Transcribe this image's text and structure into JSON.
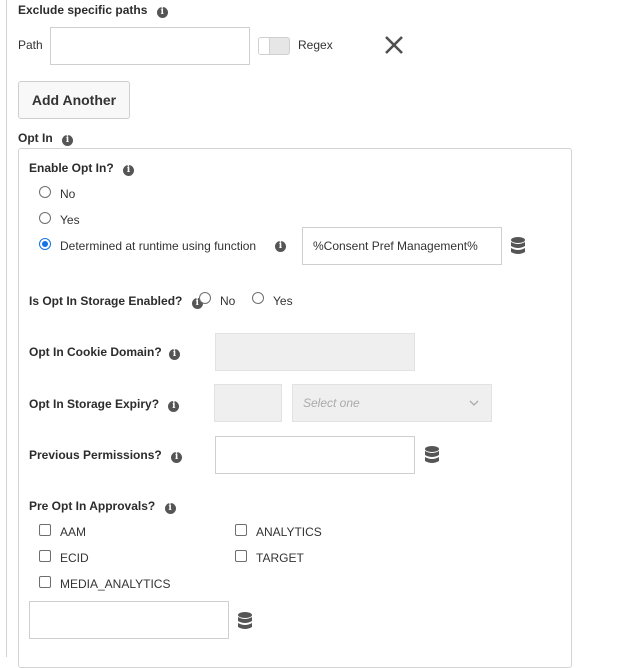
{
  "exclude": {
    "title": "Exclude specific paths",
    "path_label": "Path",
    "path_value": "",
    "regex_label": "Regex",
    "regex_on": false,
    "add_another": "Add Another"
  },
  "optin": {
    "title": "Opt In",
    "enable": {
      "label": "Enable Opt In?",
      "options": [
        "No",
        "Yes",
        "Determined at runtime using function"
      ],
      "selected": "Determined at runtime using function",
      "function_value": "%Consent Pref Management%"
    },
    "storage_enabled": {
      "label": "Is Opt In Storage Enabled?",
      "options": [
        "No",
        "Yes"
      ]
    },
    "cookie_domain": {
      "label": "Opt In Cookie Domain?",
      "value": ""
    },
    "storage_expiry": {
      "label": "Opt In Storage Expiry?",
      "value": "",
      "select_placeholder": "Select one"
    },
    "previous_permissions": {
      "label": "Previous Permissions?",
      "value": ""
    },
    "pre_approvals": {
      "label": "Pre Opt In Approvals?",
      "options": [
        "AAM",
        "ANALYTICS",
        "ECID",
        "TARGET",
        "MEDIA_ANALYTICS"
      ],
      "value": ""
    }
  },
  "icons": {
    "info": "i",
    "close": "✕",
    "chevron": "⌄"
  },
  "colors": {
    "accent": "#1473e6",
    "border": "#d3d3d3",
    "disabled_bg": "#efefef"
  }
}
